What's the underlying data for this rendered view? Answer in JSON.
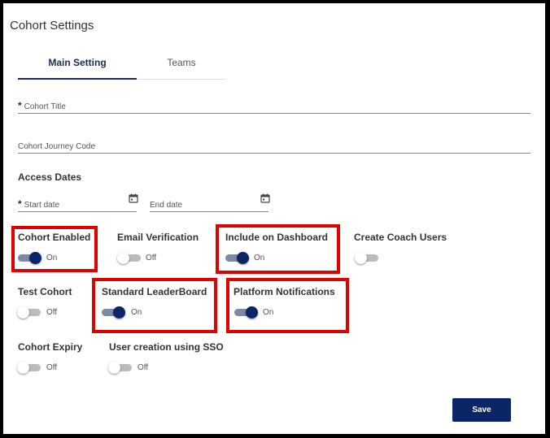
{
  "window": {
    "title": "Cohort Settings"
  },
  "tabs": [
    {
      "label": "Main Setting",
      "active": true
    },
    {
      "label": "Teams",
      "active": false
    }
  ],
  "form": {
    "cohort_title": {
      "required_mark": "*",
      "placeholder": "Cohort Title",
      "value": ""
    },
    "journey_code": {
      "placeholder": "Cohort Journey Code",
      "value": ""
    },
    "access_dates_label": "Access Dates",
    "start_date": {
      "required_mark": "*",
      "placeholder": "Start date",
      "icon": "calendar-icon"
    },
    "end_date": {
      "placeholder": "End date",
      "icon": "calendar-icon"
    }
  },
  "options": {
    "cohort_enabled": {
      "label": "Cohort Enabled",
      "state": "On",
      "on": true,
      "highlighted": true
    },
    "email_verification": {
      "label": "Email Verification",
      "state": "Off",
      "on": false,
      "highlighted": false
    },
    "include_dashboard": {
      "label": "Include on Dashboard",
      "state": "On",
      "on": true,
      "highlighted": true
    },
    "create_coach": {
      "label": "Create Coach Users",
      "state": "",
      "on": false,
      "highlighted": false
    },
    "test_cohort": {
      "label": "Test Cohort",
      "state": "Off",
      "on": false,
      "highlighted": false
    },
    "leaderboard": {
      "label": "Standard LeaderBoard",
      "state": "On",
      "on": true,
      "highlighted": true
    },
    "notifications": {
      "label": "Platform Notifications",
      "state": "On",
      "on": true,
      "highlighted": true
    },
    "cohort_expiry": {
      "label": "Cohort Expiry",
      "state": "Off",
      "on": false,
      "highlighted": false
    },
    "sso": {
      "label": "User creation using SSO",
      "state": "Off",
      "on": false,
      "highlighted": false
    }
  },
  "footer": {
    "save_label": "Save"
  },
  "colors": {
    "primary": "#0c2566",
    "highlight": "#e00000",
    "toggle_track_on": "#7e89a6",
    "toggle_track_off": "#bbbbbb"
  }
}
